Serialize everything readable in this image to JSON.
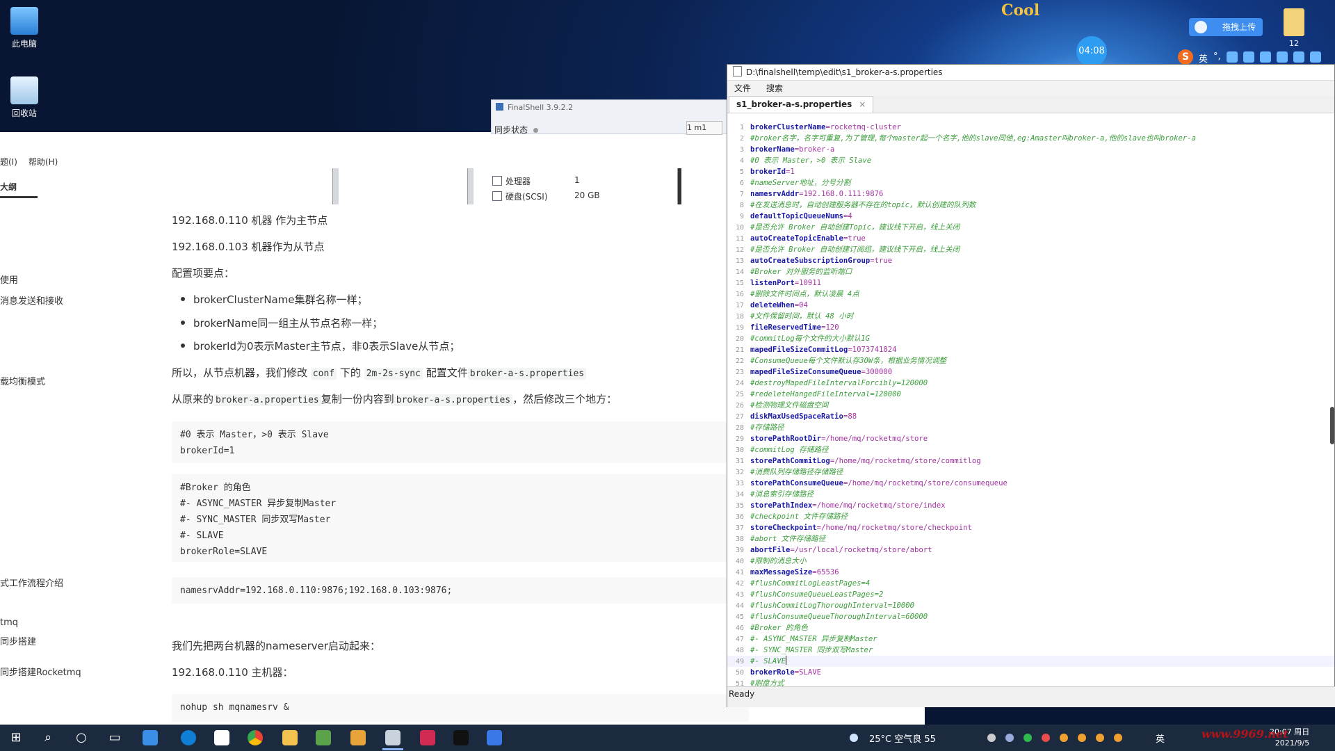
{
  "desktop": {
    "icons": [
      {
        "label": "此电脑"
      },
      {
        "label": "回收站"
      }
    ],
    "cool_badge": "Cool",
    "timer": "04:08",
    "upload_label": "拖拽上传",
    "corner_badge": "12",
    "ime_chars": [
      "英",
      "°,"
    ]
  },
  "finalshell": {
    "title": "FinalShell 3.9.2.2",
    "sync_label": "同步状态",
    "tab_label": "1 m1",
    "hardware": [
      {
        "name": "处理器",
        "value": "1"
      },
      {
        "name": "硬盘(SCSI)",
        "value": "20 GB"
      }
    ]
  },
  "doc": {
    "menu": [
      "题(I)",
      "帮助(H)"
    ],
    "outline_tab": "大纲",
    "sidebar": [
      "使用",
      "消息发送和接收",
      "载均衡模式",
      "式工作流程介绍",
      "tmq",
      "同步搭建",
      "同步搭建Rocketmq"
    ],
    "p1": "192.168.0.110 机器 作为主节点",
    "p2": "192.168.0.103 机器作为从节点",
    "p3": "配置项要点：",
    "bullets": [
      "brokerClusterName集群名称一样；",
      "brokerName同一组主从节点名称一样；",
      "brokerId为0表示Master主节点，非0表示Slave从节点；"
    ],
    "p4_a": "所以，从节点机器，我们修改",
    "p4_code1": "conf",
    "p4_b": "下的",
    "p4_code2": "2m-2s-sync",
    "p4_c": "配置文件",
    "p4_code3": "broker-a-s.properties",
    "p5_a": "从原来的",
    "p5_code1": "broker-a.properties",
    "p5_b": "复制一份内容到",
    "p5_code2": "broker-a-s.properties",
    "p5_c": "，然后修改三个地方：",
    "code1": "#0 表示 Master，>0 表示 Slave\nbrokerId=1",
    "code2": "#Broker 的角色\n#- ASYNC_MASTER 异步复制Master\n#- SYNC_MASTER 同步双写Master\n#- SLAVE\nbrokerRole=SLAVE",
    "code3": "namesrvAddr=192.168.0.110:9876;192.168.0.103:9876;",
    "p6": "我们先把两台机器的nameserver启动起来：",
    "p7": "192.168.0.110 主机器：",
    "code4": "nohup sh mqnamesrv &"
  },
  "editor": {
    "title": "D:\\finalshell\\temp\\edit\\s1_broker-a-s.properties",
    "menu": [
      "文件",
      "搜索"
    ],
    "tab": "s1_broker-a-s.properties",
    "tab_close": "×",
    "status": "Ready",
    "lines": [
      {
        "n": "1",
        "k": "brokerClusterName",
        "v": "rocketmq-cluster"
      },
      {
        "n": "2",
        "c": "#broker名字，名字可重复,为了管理,每个master起一个名字,他的slave同他,eg:Amaster叫broker-a,他的slave也叫broker-a"
      },
      {
        "n": "3",
        "k": "brokerName",
        "v": "broker-a"
      },
      {
        "n": "4",
        "c": "#0 表示 Master，>0 表示 Slave"
      },
      {
        "n": "5",
        "k": "brokerId",
        "v": "1"
      },
      {
        "n": "6",
        "c": "#nameServer地址，分号分割"
      },
      {
        "n": "7",
        "k": "namesrvAddr",
        "v": "192.168.0.111:9876"
      },
      {
        "n": "8",
        "c": "#在发送消息时，自动创建服务器不存在的topic，默认创建的队列数"
      },
      {
        "n": "9",
        "k": "defaultTopicQueueNums",
        "v": "4"
      },
      {
        "n": "10",
        "c": "#是否允许 Broker 自动创建Topic，建议线下开启，线上关闭"
      },
      {
        "n": "11",
        "k": "autoCreateTopicEnable",
        "v": "true"
      },
      {
        "n": "12",
        "c": "#是否允许 Broker 自动创建订阅组，建议线下开启，线上关闭"
      },
      {
        "n": "13",
        "k": "autoCreateSubscriptionGroup",
        "v": "true"
      },
      {
        "n": "14",
        "c": "#Broker 对外服务的监听端口"
      },
      {
        "n": "15",
        "k": "listenPort",
        "v": "10911"
      },
      {
        "n": "16",
        "c": "#删除文件时间点，默认凌晨 4点"
      },
      {
        "n": "17",
        "k": "deleteWhen",
        "v": "04"
      },
      {
        "n": "18",
        "c": "#文件保留时间，默认 48 小时"
      },
      {
        "n": "19",
        "k": "fileReservedTime",
        "v": "120"
      },
      {
        "n": "20",
        "c": "#commitLog每个文件的大小默认1G"
      },
      {
        "n": "21",
        "k": "mapedFileSizeCommitLog",
        "v": "1073741824"
      },
      {
        "n": "22",
        "c": "#ConsumeQueue每个文件默认存30W条，根据业务情况调整"
      },
      {
        "n": "23",
        "k": "mapedFileSizeConsumeQueue",
        "v": "300000"
      },
      {
        "n": "24",
        "c": "#destroyMapedFileIntervalForcibly=120000"
      },
      {
        "n": "25",
        "c": "#redeleteHangedFileInterval=120000"
      },
      {
        "n": "26",
        "c": "#检测物理文件磁盘空间"
      },
      {
        "n": "27",
        "k": "diskMaxUsedSpaceRatio",
        "v": "88"
      },
      {
        "n": "28",
        "c": "#存储路径"
      },
      {
        "n": "29",
        "k": "storePathRootDir",
        "v": "/home/mq/rocketmq/store"
      },
      {
        "n": "30",
        "c": "#commitLog 存储路径"
      },
      {
        "n": "31",
        "k": "storePathCommitLog",
        "v": "/home/mq/rocketmq/store/commitlog"
      },
      {
        "n": "32",
        "c": "#消费队列存储路径存储路径"
      },
      {
        "n": "33",
        "k": "storePathConsumeQueue",
        "v": "/home/mq/rocketmq/store/consumequeue"
      },
      {
        "n": "34",
        "c": "#消息索引存储路径"
      },
      {
        "n": "35",
        "k": "storePathIndex",
        "v": "/home/mq/rocketmq/store/index"
      },
      {
        "n": "36",
        "c": "#checkpoint 文件存储路径"
      },
      {
        "n": "37",
        "k": "storeCheckpoint",
        "v": "/home/mq/rocketmq/store/checkpoint"
      },
      {
        "n": "38",
        "c": "#abort 文件存储路径"
      },
      {
        "n": "39",
        "k": "abortFile",
        "v": "/usr/local/rocketmq/store/abort"
      },
      {
        "n": "40",
        "c": "#限制的消息大小"
      },
      {
        "n": "41",
        "k": "maxMessageSize",
        "v": "65536"
      },
      {
        "n": "42",
        "c": "#flushCommitLogLeastPages=4"
      },
      {
        "n": "43",
        "c": "#flushConsumeQueueLeastPages=2"
      },
      {
        "n": "44",
        "c": "#flushCommitLogThoroughInterval=10000"
      },
      {
        "n": "45",
        "c": "#flushConsumeQueueThoroughInterval=60000"
      },
      {
        "n": "46",
        "c": "#Broker 的角色"
      },
      {
        "n": "47",
        "c": "#- ASYNC_MASTER 异步复制Master"
      },
      {
        "n": "48",
        "c": "#- SYNC_MASTER 同步双写Master"
      },
      {
        "n": "49",
        "c": "#- SLAVE",
        "cur": true
      },
      {
        "n": "50",
        "k": "brokerRole",
        "v": "SLAVE"
      },
      {
        "n": "51",
        "c": "#刷盘方式"
      }
    ]
  },
  "taskbar": {
    "weather": "25°C 空气良 55",
    "ime": "英",
    "time": "20:07 周日",
    "date": "2021/9/5",
    "watermark": "www.9969.net"
  },
  "colors": {
    "key": "#1a1aa6",
    "value": "#a233a1",
    "comment": "#3c9e3c",
    "taskbar": "#1b2a3f"
  }
}
